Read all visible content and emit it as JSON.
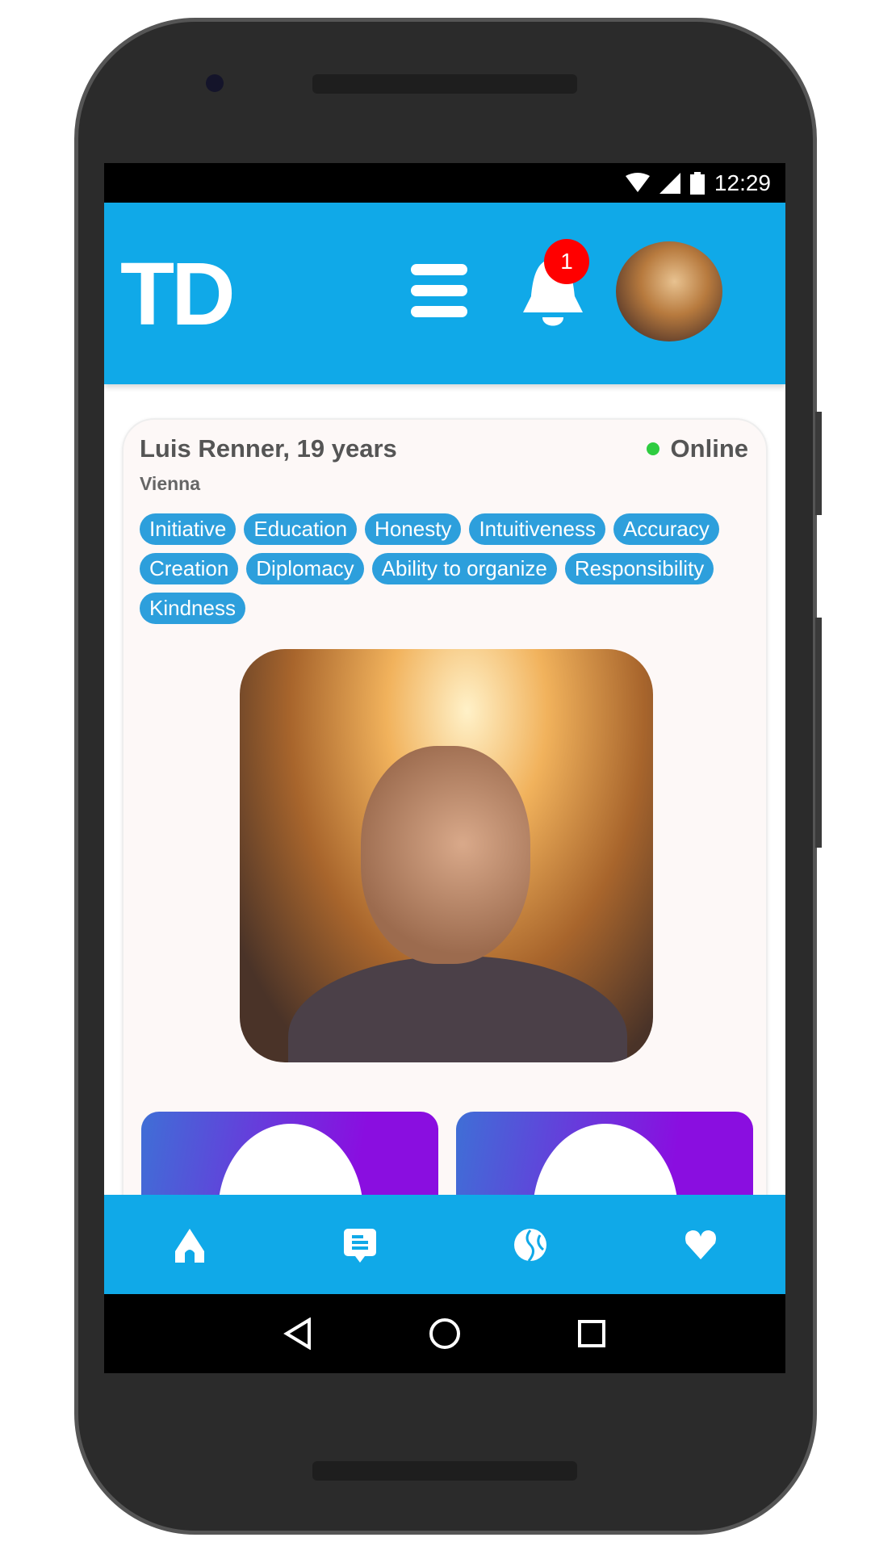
{
  "status_bar": {
    "time": "12:29",
    "icons": [
      "wifi-icon",
      "signal-icon",
      "battery-icon"
    ]
  },
  "app_bar": {
    "logo": "TD",
    "notification_count": "1"
  },
  "profile": {
    "name_age": "Luis Renner, 19 years",
    "city": "Vienna",
    "status": "Online",
    "status_color": "#2ecc40",
    "tags": [
      "Initiative",
      "Education",
      "Honesty",
      "Intuitiveness",
      "Accuracy",
      "Creation",
      "Diplomacy",
      "Ability to organize",
      "Responsibility",
      "Kindness"
    ]
  },
  "bottom_nav": {
    "items": [
      "home-icon",
      "chat-icon",
      "globe-icon",
      "heart-icon"
    ]
  },
  "colors": {
    "primary": "#10a9e8",
    "tag": "#2d9fdc",
    "badge": "#ff0000"
  }
}
